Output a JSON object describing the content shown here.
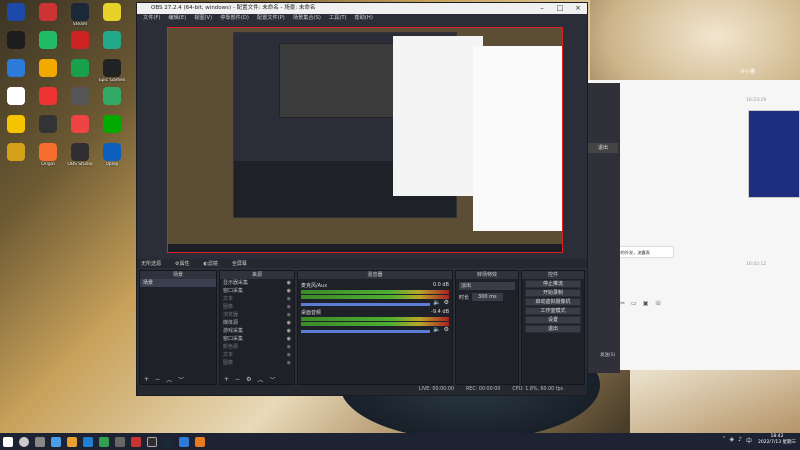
{
  "desktop_icons": [
    {
      "label": "",
      "color": "#1b4aa8",
      "icon": "brand-logo-icon"
    },
    {
      "label": "",
      "color": "#c33",
      "icon": "app-icon"
    },
    {
      "label": "Steam",
      "color": "#1b2838",
      "icon": "steam-icon"
    },
    {
      "label": "",
      "color": "#e8d22a",
      "icon": "app-icon"
    },
    {
      "label": "",
      "color": "#1d1d1d",
      "icon": "app-icon"
    },
    {
      "label": "",
      "color": "#2b6",
      "icon": "app-icon"
    },
    {
      "label": "",
      "color": "#c22",
      "icon": "app-icon"
    },
    {
      "label": "",
      "color": "#2a8",
      "icon": "app-icon"
    },
    {
      "label": "",
      "color": "#2d7bd8",
      "icon": "app-icon"
    },
    {
      "label": "",
      "color": "#f2a900",
      "icon": "app-icon"
    },
    {
      "label": "",
      "color": "#18a04a",
      "icon": "app-icon"
    },
    {
      "label": "Epic Games",
      "color": "#222",
      "icon": "epic-games-icon"
    },
    {
      "label": "",
      "color": "#fff",
      "icon": "app-icon"
    },
    {
      "label": "",
      "color": "#e33",
      "icon": "app-icon"
    },
    {
      "label": "",
      "color": "#555",
      "icon": "app-icon"
    },
    {
      "label": "",
      "color": "#3a6",
      "icon": "app-icon"
    },
    {
      "label": "",
      "color": "#f5c400",
      "icon": "app-icon"
    },
    {
      "label": "",
      "color": "#333",
      "icon": "app-icon"
    },
    {
      "label": "",
      "color": "#e44",
      "icon": "app-icon"
    },
    {
      "label": "",
      "color": "#0a0",
      "icon": "app-icon"
    },
    {
      "label": "",
      "color": "#d4a017",
      "icon": "app-icon"
    },
    {
      "label": "Origin",
      "color": "#f56c2d",
      "icon": "origin-icon"
    },
    {
      "label": "OBS Studio",
      "color": "#302e31",
      "icon": "obs-icon"
    },
    {
      "label": "Uplay",
      "color": "#0d5fbf",
      "icon": "uplay-icon"
    }
  ],
  "obs": {
    "title": "OBS 27.2.4 (64-bit, windows) - 配置文件: 未命名 - 场景: 未命名",
    "menu": [
      "文件(F)",
      "编辑(E)",
      "视图(V)",
      "停靠部件(D)",
      "配置文件(P)",
      "场景集合(S)",
      "工具(T)",
      "帮助(H)"
    ],
    "context_bar": {
      "source": "无所选源",
      "properties": "属性",
      "filters": "滤镜",
      "full_screen": "全屏幕"
    },
    "scenes": {
      "header": "场景",
      "items": [
        "场景"
      ]
    },
    "sources": {
      "header": "来源",
      "items": [
        {
          "name": "显示器采集",
          "dim": false
        },
        {
          "name": "窗口采集",
          "dim": false
        },
        {
          "name": "文本",
          "dim": true
        },
        {
          "name": "图像",
          "dim": true
        },
        {
          "name": "浏览器",
          "dim": true
        },
        {
          "name": "媒体源",
          "dim": false
        },
        {
          "name": "游戏采集",
          "dim": false
        },
        {
          "name": "窗口采集",
          "dim": false
        },
        {
          "name": "颜色源",
          "dim": true
        },
        {
          "name": "文本",
          "dim": true
        },
        {
          "name": "图像",
          "dim": true
        }
      ]
    },
    "mixer": {
      "header": "混音器",
      "tracks": [
        {
          "name": "麦克风/Aux",
          "db": "0.0 dB"
        },
        {
          "name": "桌面音频",
          "db": "-9.4 dB"
        }
      ]
    },
    "transitions": {
      "header": "转场特效",
      "type": "淡出",
      "duration_label": "时长",
      "duration": "300 ms"
    },
    "controls": {
      "header": "控件",
      "buttons": [
        "停止推流",
        "开始录制",
        "启动虚拟摄像机",
        "工作室模式",
        "设置",
        "退出"
      ]
    },
    "status": {
      "live": "LIVE: 00:00:00",
      "rec": "REC: 00:00:00",
      "cpu": "CPU: 1.8%, 60.00 fps"
    }
  },
  "chat": {
    "name": "冷小猫",
    "times": [
      "16:23:29",
      "16:42:12"
    ],
    "bubble": "由于你的外发，流露表",
    "button": "退出",
    "send_hint": "发送(S)"
  },
  "taskbar": {
    "time": "18:42",
    "date": "2022/7/13 星期三"
  }
}
